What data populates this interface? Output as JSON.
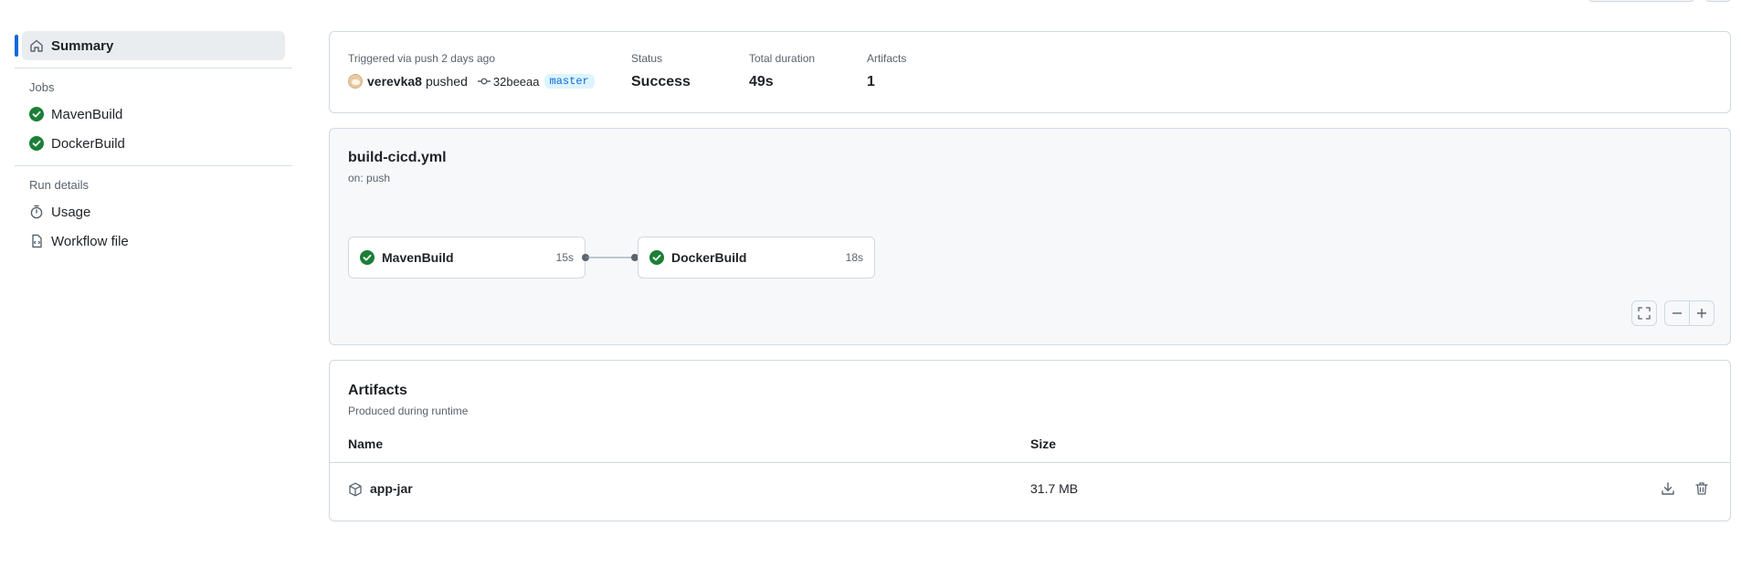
{
  "sidebar": {
    "summary_label": "Summary",
    "jobs_heading": "Jobs",
    "jobs": [
      {
        "label": "MavenBuild",
        "status": "success"
      },
      {
        "label": "DockerBuild",
        "status": "success"
      }
    ],
    "run_details_heading": "Run details",
    "run_details": [
      {
        "label": "Usage",
        "icon": "stopwatch-icon"
      },
      {
        "label": "Workflow file",
        "icon": "file-code-icon"
      }
    ]
  },
  "summary": {
    "trigger_text": "Triggered via push 2 days ago",
    "actor": "verevka8",
    "action": "pushed",
    "commit": "32beeaa",
    "branch": "master",
    "status_label": "Status",
    "status_value": "Success",
    "duration_label": "Total duration",
    "duration_value": "49s",
    "artifacts_label": "Artifacts",
    "artifacts_value": "1"
  },
  "workflow": {
    "file": "build-cicd.yml",
    "trigger": "on: push",
    "jobs": [
      {
        "name": "MavenBuild",
        "duration": "15s",
        "status": "success"
      },
      {
        "name": "DockerBuild",
        "duration": "18s",
        "status": "success"
      }
    ]
  },
  "artifacts": {
    "title": "Artifacts",
    "subtitle": "Produced during runtime",
    "columns": {
      "name": "Name",
      "size": "Size"
    },
    "rows": [
      {
        "name": "app-jar",
        "size": "31.7 MB"
      }
    ]
  },
  "colors": {
    "accent": "#0969da",
    "success": "#1a7f37",
    "branch_bg": "#ddf4ff",
    "branch_text": "#0969da"
  }
}
